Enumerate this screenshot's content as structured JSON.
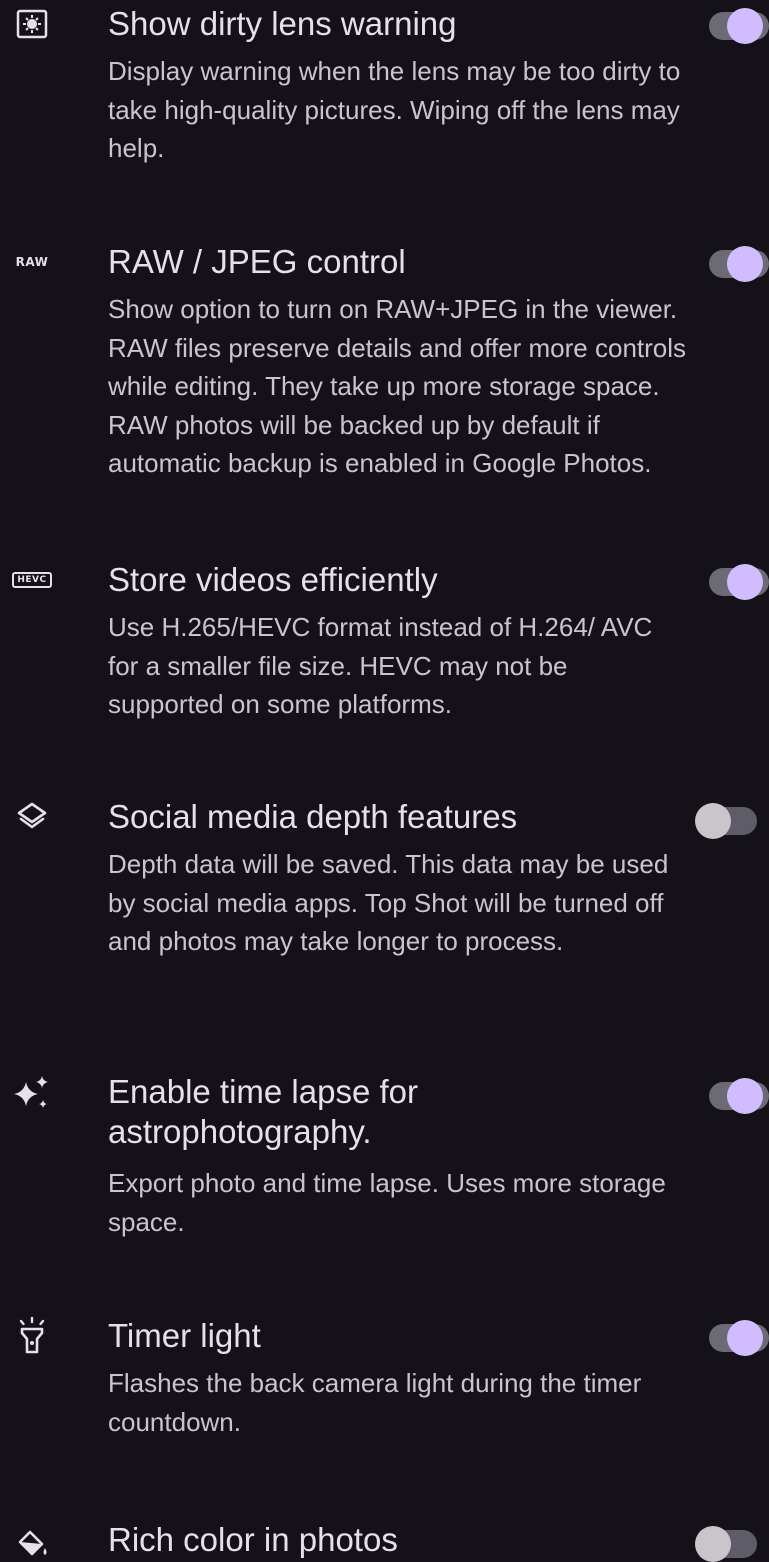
{
  "settings": [
    {
      "icon": "lens-icon",
      "title": "Show dirty lens warning",
      "description": "Display warning when the lens may be too dirty to take high-quality pictures. Wiping off the lens may help.",
      "enabled": true
    },
    {
      "icon": "raw-icon",
      "icon_text": "RAW",
      "title": "RAW / JPEG control",
      "description": "Show option to turn on RAW+JPEG in the viewer. RAW files preserve details and offer more controls while editing. They take up more storage space. RAW photos will be backed up by default if automatic backup is enabled in Google Photos.",
      "enabled": true
    },
    {
      "icon": "hevc-icon",
      "icon_text": "HEVC",
      "title": "Store videos efficiently",
      "description": "Use H.265/HEVC format instead of H.264/ AVC for a smaller file size. HEVC may not be supported on some platforms.",
      "enabled": true
    },
    {
      "icon": "layers-icon",
      "title": "Social media depth features",
      "description": "Depth data will be saved. This data may be used by social media apps. Top Shot will be turned off and photos may take longer to process.",
      "enabled": false
    },
    {
      "icon": "sparkle-icon",
      "title": "Enable time lapse for\nastrophotography.",
      "description": "Export photo and time lapse. Uses more storage space.",
      "enabled": true
    },
    {
      "icon": "flashlight-icon",
      "title": "Timer light",
      "description": "Flashes the back camera light during the timer countdown.",
      "enabled": true
    },
    {
      "icon": "rich-color-icon",
      "title": "Rich color in photos",
      "description": "",
      "enabled": false
    }
  ],
  "colors": {
    "background": "#141218",
    "toggle_on_thumb": "#d0bcff",
    "toggle_off_thumb": "#c9c5ca",
    "title_text": "#e6e0e9",
    "description_text": "#cac4d0"
  }
}
